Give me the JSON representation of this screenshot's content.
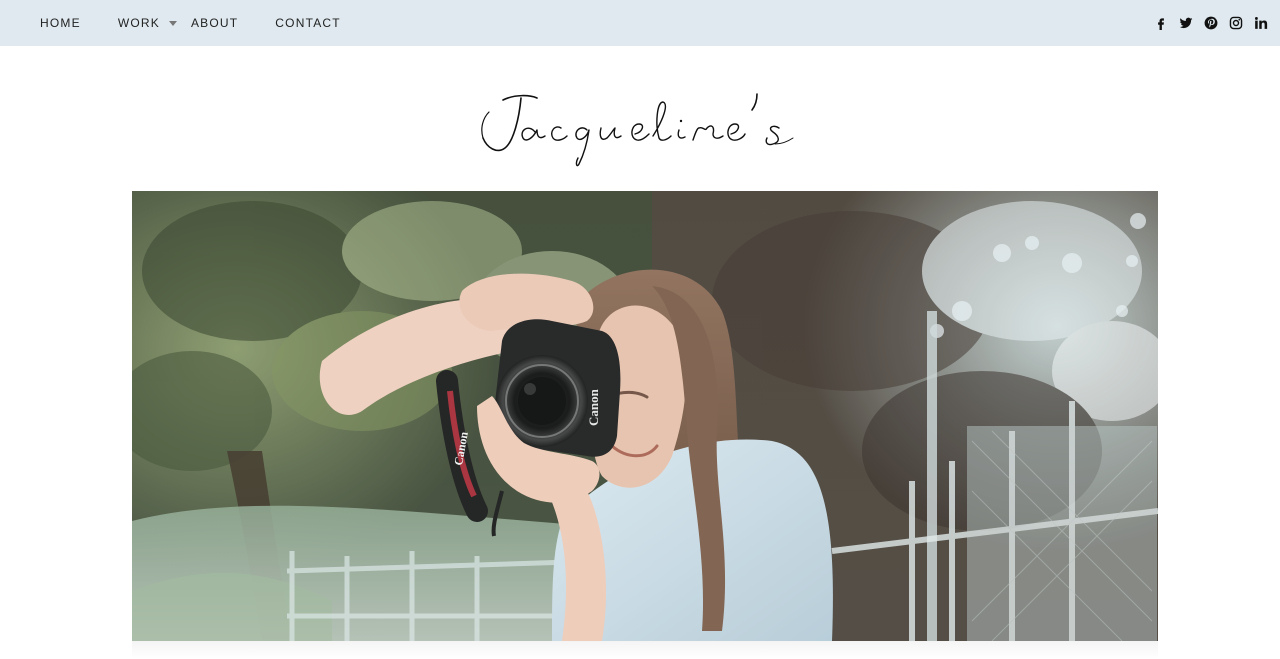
{
  "nav": {
    "items": [
      {
        "label": "HOME"
      },
      {
        "label": "WORK",
        "has_dropdown": true
      },
      {
        "label": "ABOUT"
      },
      {
        "label": "CONTACT"
      }
    ]
  },
  "social": {
    "icons": [
      "facebook-icon",
      "twitter-icon",
      "pinterest-icon",
      "instagram-icon",
      "linkedin-icon"
    ]
  },
  "brand": {
    "logo_text": "Jacqueline's"
  },
  "hero": {
    "camera_brand": "Canon",
    "strap_text": "Canon"
  },
  "colors": {
    "topbar_bg": "#dfe9ef",
    "text": "#222222",
    "background": "#ffffff"
  }
}
